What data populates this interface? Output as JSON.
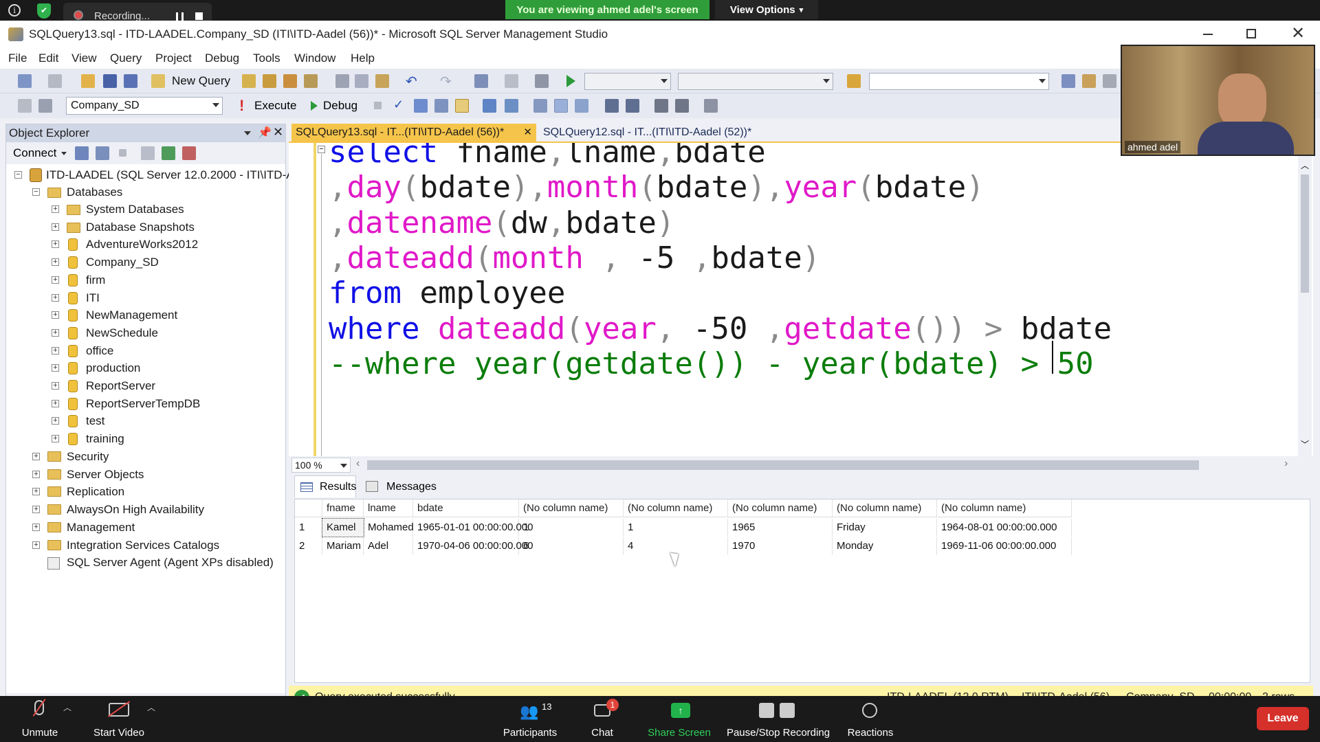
{
  "zoom": {
    "recording_label": "Recording...",
    "viewing_banner": "You are viewing ahmed adel's screen",
    "view_options": "View Options",
    "participant_name": "ahmed adel",
    "participants_count": "13",
    "chat_badge": "1",
    "bottom": {
      "unmute": "Unmute",
      "start_video": "Start Video",
      "participants": "Participants",
      "chat": "Chat",
      "share_screen": "Share Screen",
      "pause_stop": "Pause/Stop Recording",
      "reactions": "Reactions",
      "leave": "Leave"
    }
  },
  "window": {
    "title": "SQLQuery13.sql - ITD-LAADEL.Company_SD (ITI\\ITD-Aadel (56))* - Microsoft SQL Server Management Studio"
  },
  "menu": [
    "File",
    "Edit",
    "View",
    "Query",
    "Project",
    "Debug",
    "Tools",
    "Window",
    "Help"
  ],
  "toolbar": {
    "new_query": "New Query",
    "database_select": "Company_SD",
    "execute": "Execute",
    "debug": "Debug"
  },
  "object_explorer": {
    "title": "Object Explorer",
    "connect": "Connect",
    "server": "ITD-LAADEL (SQL Server 12.0.2000 - ITI\\ITD-A",
    "databases_label": "Databases",
    "databases": [
      "System Databases",
      "Database Snapshots",
      "AdventureWorks2012",
      "Company_SD",
      "firm",
      "ITI",
      "NewManagement",
      "NewSchedule",
      "office",
      "production",
      "ReportServer",
      "ReportServerTempDB",
      "test",
      "training"
    ],
    "server_nodes": [
      "Security",
      "Server Objects",
      "Replication",
      "AlwaysOn High Availability",
      "Management",
      "Integration Services Catalogs",
      "SQL Server Agent (Agent XPs disabled)"
    ]
  },
  "tabs": [
    {
      "label": "SQLQuery13.sql - IT...(ITI\\ITD-Aadel (56))*",
      "active": true
    },
    {
      "label": "SQLQuery12.sql - IT...(ITI\\ITD-Aadel (52))*",
      "active": false
    }
  ],
  "editor": {
    "zoom": "100 %",
    "lines": [
      [
        {
          "t": "select ",
          "c": "kw"
        },
        {
          "t": "fname",
          "c": "pl"
        },
        {
          "t": ",",
          "c": "gr"
        },
        {
          "t": "lname",
          "c": "pl"
        },
        {
          "t": ",",
          "c": "gr"
        },
        {
          "t": "bdate",
          "c": "pl"
        }
      ],
      [
        {
          "t": ",",
          "c": "gr"
        },
        {
          "t": "day",
          "c": "fn"
        },
        {
          "t": "(",
          "c": "gr"
        },
        {
          "t": "bdate",
          "c": "pl"
        },
        {
          "t": "),",
          "c": "gr"
        },
        {
          "t": "month",
          "c": "fn"
        },
        {
          "t": "(",
          "c": "gr"
        },
        {
          "t": "bdate",
          "c": "pl"
        },
        {
          "t": "),",
          "c": "gr"
        },
        {
          "t": "year",
          "c": "fn"
        },
        {
          "t": "(",
          "c": "gr"
        },
        {
          "t": "bdate",
          "c": "pl"
        },
        {
          "t": ")",
          "c": "gr"
        }
      ],
      [
        {
          "t": ",",
          "c": "gr"
        },
        {
          "t": "datename",
          "c": "fn"
        },
        {
          "t": "(",
          "c": "gr"
        },
        {
          "t": "dw",
          "c": "pl"
        },
        {
          "t": ",",
          "c": "gr"
        },
        {
          "t": "bdate",
          "c": "pl"
        },
        {
          "t": ")",
          "c": "gr"
        }
      ],
      [
        {
          "t": ",",
          "c": "gr"
        },
        {
          "t": "dateadd",
          "c": "fn"
        },
        {
          "t": "(",
          "c": "gr"
        },
        {
          "t": "month",
          "c": "fn"
        },
        {
          "t": " , ",
          "c": "gr"
        },
        {
          "t": "-5",
          "c": "pl"
        },
        {
          "t": " ,",
          "c": "gr"
        },
        {
          "t": "bdate",
          "c": "pl"
        },
        {
          "t": ")",
          "c": "gr"
        }
      ],
      [
        {
          "t": "from ",
          "c": "kw"
        },
        {
          "t": "employee",
          "c": "pl"
        }
      ],
      [
        {
          "t": "where ",
          "c": "kw"
        },
        {
          "t": "dateadd",
          "c": "fn"
        },
        {
          "t": "(",
          "c": "gr"
        },
        {
          "t": "year",
          "c": "fn"
        },
        {
          "t": ", ",
          "c": "gr"
        },
        {
          "t": "-50",
          "c": "pl"
        },
        {
          "t": " ,",
          "c": "gr"
        },
        {
          "t": "getdate",
          "c": "fn"
        },
        {
          "t": "()) > ",
          "c": "gr"
        },
        {
          "t": "bdate",
          "c": "pl"
        }
      ],
      [
        {
          "t": "--where year(getdate()) - year(bdate) > 50",
          "c": "cm"
        }
      ]
    ]
  },
  "results": {
    "tab_results": "Results",
    "tab_messages": "Messages",
    "columns": [
      "fname",
      "lname",
      "bdate",
      "(No column name)",
      "(No column name)",
      "(No column name)",
      "(No column name)",
      "(No column name)"
    ],
    "rows": [
      [
        "1",
        "Kamel",
        "Mohamed",
        "1965-01-01 00:00:00.000",
        "1",
        "1",
        "1965",
        "Friday",
        "1964-08-01 00:00:00.000"
      ],
      [
        "2",
        "Mariam",
        "Adel",
        "1970-04-06 00:00:00.000",
        "6",
        "4",
        "1970",
        "Monday",
        "1969-11-06 00:00:00.000"
      ]
    ]
  },
  "status": {
    "message": "Query executed successfully.",
    "server": "ITD-LAADEL (12.0 RTM)",
    "user": "ITI\\ITD-Aadel (56)",
    "database": "Company_SD",
    "time": "00:00:00",
    "rows": "2 rows"
  },
  "colors": {
    "keyword": "#1010e6",
    "function": "#e019c8",
    "comment": "#0b7d0b",
    "banner": "#2f9e3a",
    "leave": "#d6302a",
    "status_bar": "#fdf4a6"
  }
}
